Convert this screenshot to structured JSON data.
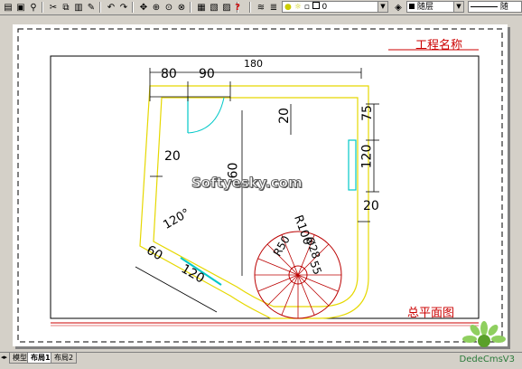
{
  "toolbar": {
    "layer_value": "0",
    "color_value": "随层",
    "linetype_value": "随",
    "help_label": "?"
  },
  "drawing": {
    "project_title": "工程名称",
    "plan_title": "总平面图",
    "watermark_text": "Softyesky.com",
    "dims": {
      "top_total": "180",
      "top_left": "80",
      "top_right": "90",
      "wall_thickness": "20",
      "right_top": "75",
      "right_window": "120",
      "left_wall": "20",
      "center_vertical": "260",
      "right_wall": "20",
      "angle": "120°",
      "bottom_60": "60",
      "bottom_120": "120",
      "radius_100": "R100",
      "radius_50": "R50",
      "dia_28": "Ø28",
      "dia_55": "55"
    }
  },
  "tabs": [
    {
      "label": "模型"
    },
    {
      "label": "布局1"
    },
    {
      "label": "布局2"
    }
  ],
  "logo_text": "DedeCmsV3"
}
